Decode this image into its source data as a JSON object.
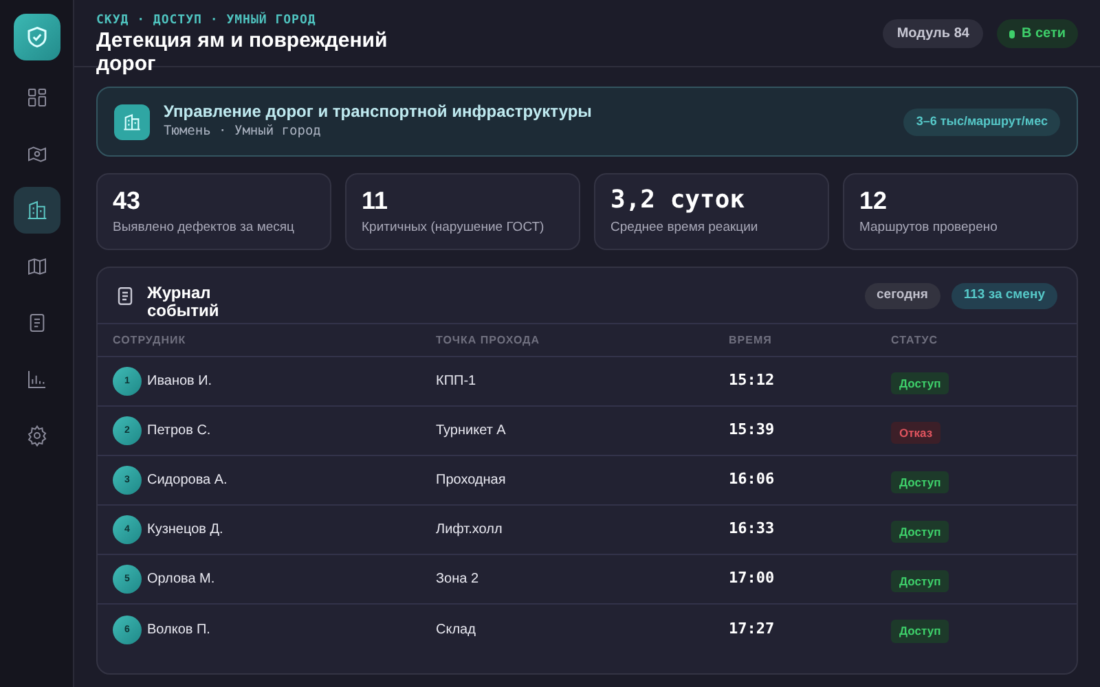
{
  "sidebar": {
    "items": [
      {
        "selected": false
      },
      {
        "selected": false
      },
      {
        "selected": true
      },
      {
        "selected": false
      },
      {
        "selected": false
      },
      {
        "selected": false
      },
      {
        "selected": false
      }
    ]
  },
  "header": {
    "breadcrumb": "СКУД · ДОСТУП · УМНЫЙ ГОРОД",
    "title": "Детекция ям и повреждений дорог",
    "module": "Модуль 84",
    "status": "В сети"
  },
  "banner": {
    "title": "Управление дорог и транспортной инфраструктуры",
    "subtitle": "Тюмень · Умный город",
    "price": "3–6 тыс/маршрут/мес"
  },
  "stats": [
    {
      "value": "43",
      "label": "Выявлено дефектов за месяц",
      "kind": "count"
    },
    {
      "value": "11",
      "label": "Критичных (нарушение ГОСТ)",
      "kind": "count"
    },
    {
      "value": "3,2 суток",
      "label": "Среднее время реакции",
      "kind": "duration"
    },
    {
      "value": "12",
      "label": "Маршрутов проверено",
      "kind": "count"
    }
  ],
  "log": {
    "title": "Журнал событий",
    "period": "сегодня",
    "count": "113 за смену",
    "columns": [
      "СОТРУДНИК",
      "ТОЧКА ПРОХОДА",
      "ВРЕМЯ",
      "СТАТУС"
    ],
    "rows": [
      {
        "n": "1",
        "name": "Иванов И.",
        "point": "КПП-1",
        "time": "15:12",
        "status": "Доступ",
        "kind": "granted"
      },
      {
        "n": "2",
        "name": "Петров С.",
        "point": "Турникет А",
        "time": "15:39",
        "status": "Отказ",
        "kind": "denied"
      },
      {
        "n": "3",
        "name": "Сидорова А.",
        "point": "Проходная",
        "time": "16:06",
        "status": "Доступ",
        "kind": "granted"
      },
      {
        "n": "4",
        "name": "Кузнецов Д.",
        "point": "Лифт.холл",
        "time": "16:33",
        "status": "Доступ",
        "kind": "granted"
      },
      {
        "n": "5",
        "name": "Орлова М.",
        "point": "Зона 2",
        "time": "17:00",
        "status": "Доступ",
        "kind": "granted"
      },
      {
        "n": "6",
        "name": "Волков П.",
        "point": "Склад",
        "time": "17:27",
        "status": "Доступ",
        "kind": "granted"
      }
    ]
  }
}
